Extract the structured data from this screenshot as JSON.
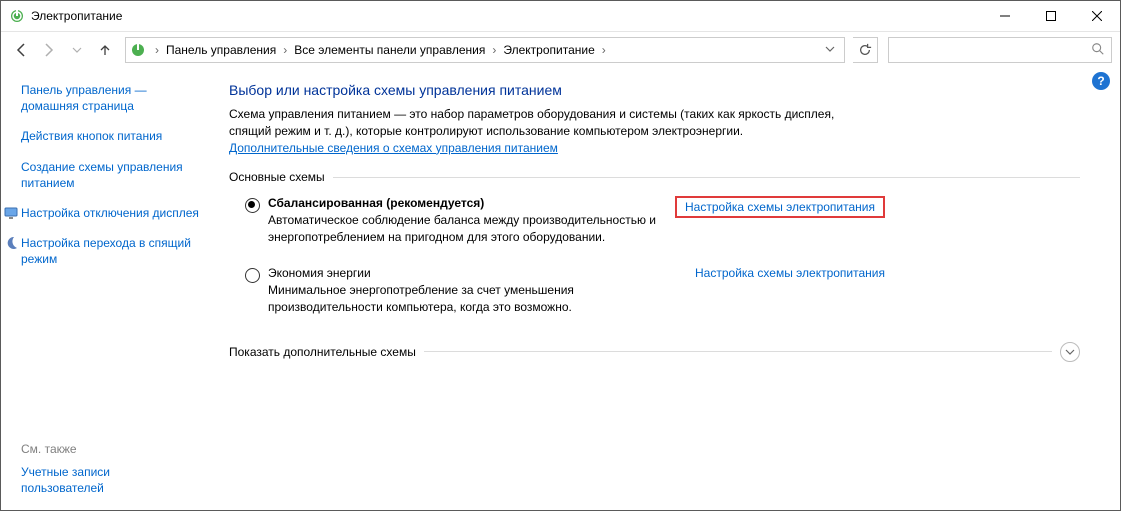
{
  "window": {
    "title": "Электропитание"
  },
  "breadcrumbs": {
    "root": "Панель управления",
    "mid": "Все элементы панели управления",
    "leaf": "Электропитание"
  },
  "search": {
    "placeholder": ""
  },
  "sidebar": {
    "home": "Панель управления — домашняя страница",
    "items": [
      {
        "label": "Действия кнопок питания",
        "icon": null
      },
      {
        "label": "Создание схемы управления питанием",
        "icon": null
      },
      {
        "label": "Настройка отключения дисплея",
        "icon": "monitor"
      },
      {
        "label": "Настройка перехода в спящий режим",
        "icon": "moon"
      }
    ],
    "see_also_title": "См. также",
    "see_also_items": [
      {
        "label": "Учетные записи пользователей"
      }
    ]
  },
  "main": {
    "heading": "Выбор или настройка схемы управления питанием",
    "description": "Схема управления питанием — это набор параметров оборудования и системы (таких как яркость дисплея, спящий режим и т. д.), которые контролируют использование компьютером электроэнергии.",
    "more_link": "Дополнительные сведения о схемах управления питанием",
    "group1_label": "Основные схемы",
    "plans": [
      {
        "selected": true,
        "name": "Сбалансированная (рекомендуется)",
        "desc": "Автоматическое соблюдение баланса между производительностью и энергопотреблением на пригодном для этого оборудовании.",
        "change_link": "Настройка схемы электропитания",
        "highlight": true
      },
      {
        "selected": false,
        "name": "Экономия энергии",
        "desc": "Минимальное энергопотребление за счет уменьшения производительности компьютера, когда это возможно.",
        "change_link": "Настройка схемы электропитания",
        "highlight": false
      }
    ],
    "group2_label": "Показать дополнительные схемы"
  }
}
